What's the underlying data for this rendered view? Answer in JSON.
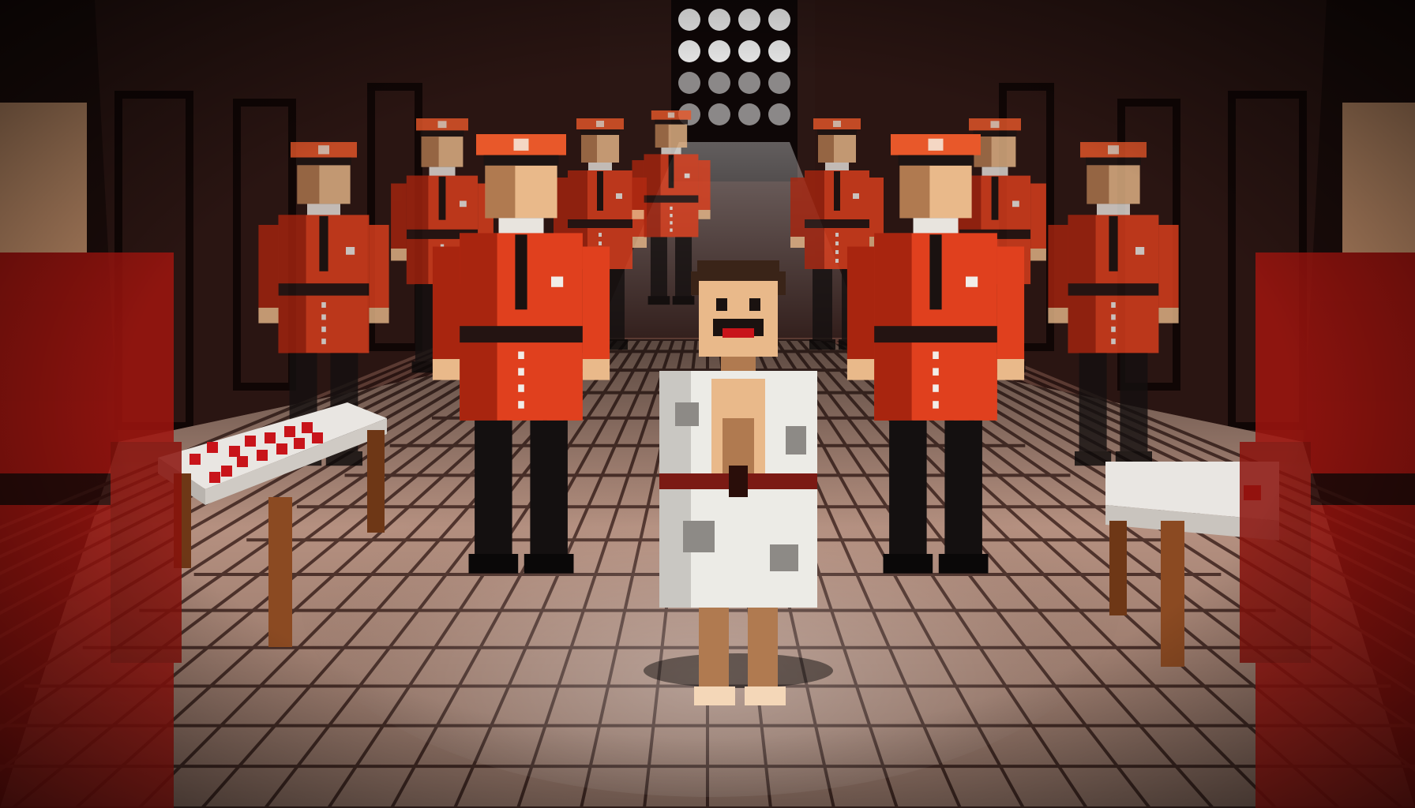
{
  "scene": {
    "colors": {
      "wall": "#2a1512",
      "wall_dark": "#140909",
      "floor_tile": "#c9a08e",
      "floor_grout": "#5a3a32",
      "uniform_red": "#e0401e",
      "uniform_shadow": "#a8250f",
      "cap_orange": "#e8582a",
      "trousers": "#141010",
      "skin": "#e9b98a",
      "skin_shadow": "#b07a50",
      "robe_white": "#ecebe6",
      "robe_grey": "#8d8a86",
      "hair": "#3a2418",
      "table_top": "#e9e6e2",
      "table_wood": "#8b4a22",
      "token_red": "#c8141a",
      "window_light": "#f3f3f3"
    },
    "icons": [
      "pixel-guard-figure",
      "pixel-prisoner-figure",
      "barred-window",
      "table",
      "red-token"
    ]
  }
}
